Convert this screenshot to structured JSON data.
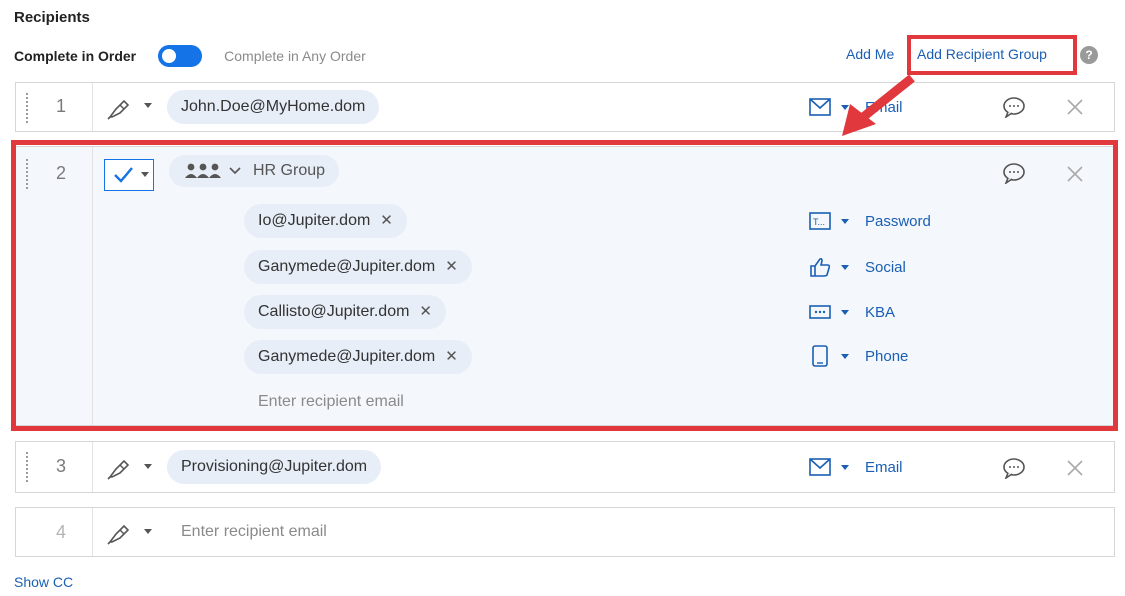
{
  "header": {
    "title": "Recipients",
    "order_active": "Complete in Order",
    "order_inactive": "Complete in Any Order",
    "add_me": "Add Me",
    "add_group": "Add Recipient Group",
    "help": "?"
  },
  "rows": [
    {
      "number": "1",
      "email": "John.Doe@MyHome.dom",
      "auth": "Email",
      "auth_icon": "envelope-icon"
    },
    {
      "number": "2",
      "group_name": "HR Group",
      "members": [
        {
          "email": "Io@Jupiter.dom",
          "auth": "Password",
          "auth_icon": "password-icon"
        },
        {
          "email": "Ganymede@Jupiter.dom",
          "auth": "Social",
          "auth_icon": "thumbs-up-icon"
        },
        {
          "email": "Callisto@Jupiter.dom",
          "auth": "KBA",
          "auth_icon": "kba-icon"
        },
        {
          "email": "Ganymede@Jupiter.dom",
          "auth": "Phone",
          "auth_icon": "phone-icon"
        }
      ],
      "placeholder": "Enter recipient email"
    },
    {
      "number": "3",
      "email": "Provisioning@Jupiter.dom",
      "auth": "Email",
      "auth_icon": "envelope-icon"
    },
    {
      "number": "4",
      "placeholder": "Enter recipient email"
    }
  ],
  "footer": {
    "show_cc": "Show CC"
  },
  "colors": {
    "accent": "#1473e6",
    "link": "#1a5fb4",
    "highlight": "#e0383c",
    "pill": "#e8eef7"
  }
}
